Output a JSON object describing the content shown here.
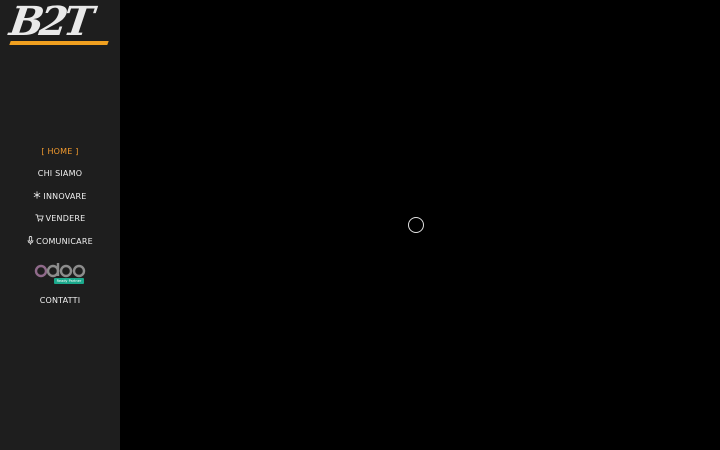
{
  "logo": {
    "text": "B2T"
  },
  "nav": {
    "items": [
      {
        "label": "[ HOME ]",
        "icon": "",
        "active": true
      },
      {
        "label": "CHI SIAMO",
        "icon": ""
      },
      {
        "label": "INNOVARE",
        "icon": "snowflake-icon",
        "glyph": "❄"
      },
      {
        "label": "VENDERE",
        "icon": "cart-icon",
        "glyph": "🛒"
      },
      {
        "label": "COMUNICARE",
        "icon": "microphone-icon",
        "glyph": "🎙"
      }
    ],
    "partner": {
      "brand": "odoo",
      "badge": "Ready Partner"
    },
    "contact": {
      "label": "CONTATTI"
    }
  },
  "colors": {
    "accent": "#f29a2e",
    "sidebar_bg": "#1e1e1e",
    "main_bg": "#000000",
    "odoo_badge": "#1ba98c"
  },
  "main": {
    "state": "loading",
    "indicator": "spinner"
  }
}
